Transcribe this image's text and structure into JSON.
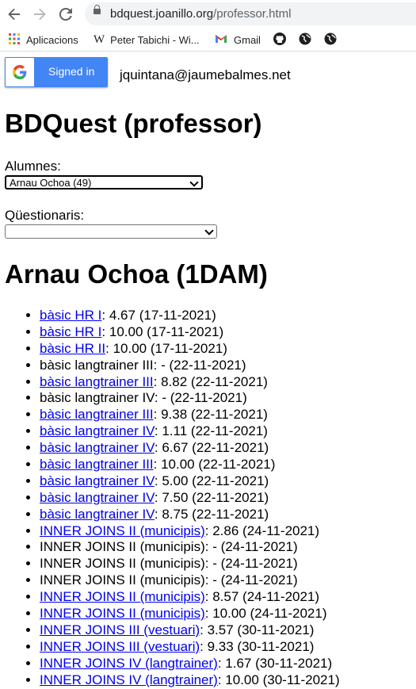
{
  "browser": {
    "url_host": "bdquest.joanillo.org",
    "url_path": "/professor.html",
    "bookmarks": [
      {
        "label": "Aplicacions",
        "icon": "apps-grid-icon"
      },
      {
        "label": "Peter Tabichi - Wi...",
        "icon": "wikipedia-icon"
      },
      {
        "label": "Gmail",
        "icon": "gmail-icon"
      },
      {
        "label": "",
        "icon": "github-icon"
      },
      {
        "label": "",
        "icon": "globe-icon"
      },
      {
        "label": "",
        "icon": "globe-icon"
      }
    ]
  },
  "auth": {
    "button_label": "Signed in",
    "email": "jquintana@jaumebalmes.net"
  },
  "page": {
    "title": "BDQuest (professor)",
    "students_label": "Alumnes:",
    "students_selected": "Arnau Ochoa (49)",
    "quizzes_label": "Qüestionaris:",
    "quizzes_selected": "",
    "student_heading": "Arnau Ochoa (1DAM)"
  },
  "results": [
    {
      "name": "bàsic HR I",
      "linked": true,
      "score": "4.67",
      "date": "17-11-2021"
    },
    {
      "name": "bàsic HR I",
      "linked": true,
      "score": "10.00",
      "date": "17-11-2021"
    },
    {
      "name": "bàsic HR II",
      "linked": true,
      "score": "10.00",
      "date": "17-11-2021"
    },
    {
      "name": "bàsic langtrainer III",
      "linked": false,
      "score": "-",
      "date": "22-11-2021"
    },
    {
      "name": "bàsic langtrainer III",
      "linked": true,
      "score": "8.82",
      "date": "22-11-2021"
    },
    {
      "name": "bàsic langtrainer IV",
      "linked": false,
      "score": "-",
      "date": "22-11-2021"
    },
    {
      "name": "bàsic langtrainer III",
      "linked": true,
      "score": "9.38",
      "date": "22-11-2021"
    },
    {
      "name": "bàsic langtrainer IV",
      "linked": true,
      "score": "1.11",
      "date": "22-11-2021"
    },
    {
      "name": "bàsic langtrainer IV",
      "linked": true,
      "score": "6.67",
      "date": "22-11-2021"
    },
    {
      "name": "bàsic langtrainer III",
      "linked": true,
      "score": "10.00",
      "date": "22-11-2021"
    },
    {
      "name": "bàsic langtrainer IV",
      "linked": true,
      "score": "5.00",
      "date": "22-11-2021"
    },
    {
      "name": "bàsic langtrainer IV",
      "linked": true,
      "score": "7.50",
      "date": "22-11-2021"
    },
    {
      "name": "bàsic langtrainer IV",
      "linked": true,
      "score": "8.75",
      "date": "22-11-2021"
    },
    {
      "name": "INNER JOINS II (municipis)",
      "linked": true,
      "score": "2.86",
      "date": "24-11-2021"
    },
    {
      "name": "INNER JOINS II (municipis)",
      "linked": false,
      "score": "-",
      "date": "24-11-2021"
    },
    {
      "name": "INNER JOINS II (municipis)",
      "linked": false,
      "score": "-",
      "date": "24-11-2021"
    },
    {
      "name": "INNER JOINS II (municipis)",
      "linked": false,
      "score": "-",
      "date": "24-11-2021"
    },
    {
      "name": "INNER JOINS II (municipis)",
      "linked": true,
      "score": "8.57",
      "date": "24-11-2021"
    },
    {
      "name": "INNER JOINS II (municipis)",
      "linked": true,
      "score": "10.00",
      "date": "24-11-2021"
    },
    {
      "name": "INNER JOINS III (vestuari)",
      "linked": true,
      "score": "3.57",
      "date": "30-11-2021"
    },
    {
      "name": "INNER JOINS III (vestuari)",
      "linked": true,
      "score": "9.33",
      "date": "30-11-2021"
    },
    {
      "name": "INNER JOINS IV (langtrainer)",
      "linked": true,
      "score": "1.67",
      "date": "30-11-2021"
    },
    {
      "name": "INNER JOINS IV (langtrainer)",
      "linked": true,
      "score": "10.00",
      "date": "30-11-2021"
    }
  ]
}
